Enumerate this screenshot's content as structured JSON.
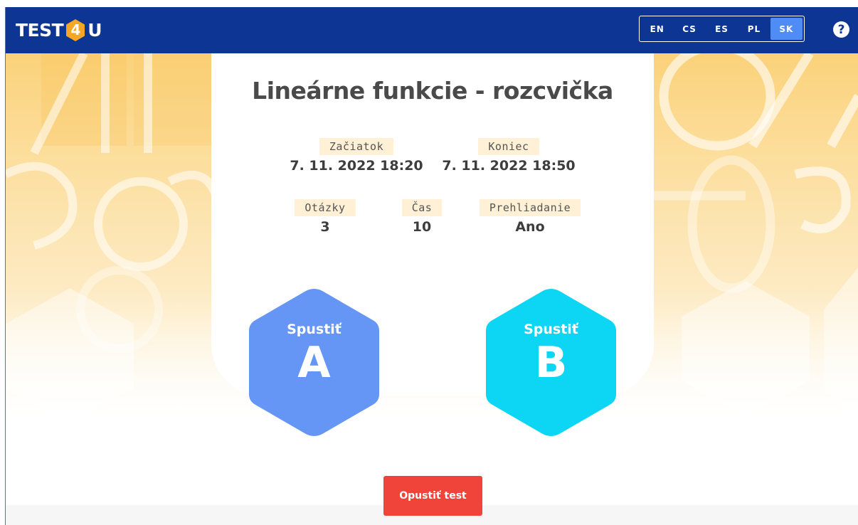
{
  "header": {
    "logo_left": "TEST",
    "logo_digit": "4",
    "logo_right": "U",
    "languages": [
      "EN",
      "CS",
      "ES",
      "PL",
      "SK"
    ],
    "active_language": "SK",
    "help_symbol": "?"
  },
  "test": {
    "title": "Lineárne funkcie - rozcvička",
    "start": {
      "label": "Začiatok",
      "value": "7. 11. 2022 18:20"
    },
    "end": {
      "label": "Koniec",
      "value": "7. 11. 2022 18:50"
    },
    "questions": {
      "label": "Otázky",
      "value": "3"
    },
    "time": {
      "label": "Čas",
      "value": "10"
    },
    "review": {
      "label": "Prehliadanie",
      "value": "Ano"
    }
  },
  "variants": [
    {
      "label": "Spustiť",
      "letter": "A",
      "color": "#6596f6"
    },
    {
      "label": "Spustiť",
      "letter": "B",
      "color": "#0cd6f4"
    }
  ],
  "leave_button": "Opustiť test",
  "colors": {
    "header": "#0d3593",
    "logo_hex": "#f5a623",
    "leave_button": "#f0443a",
    "label_bg": "#fff0d6"
  }
}
